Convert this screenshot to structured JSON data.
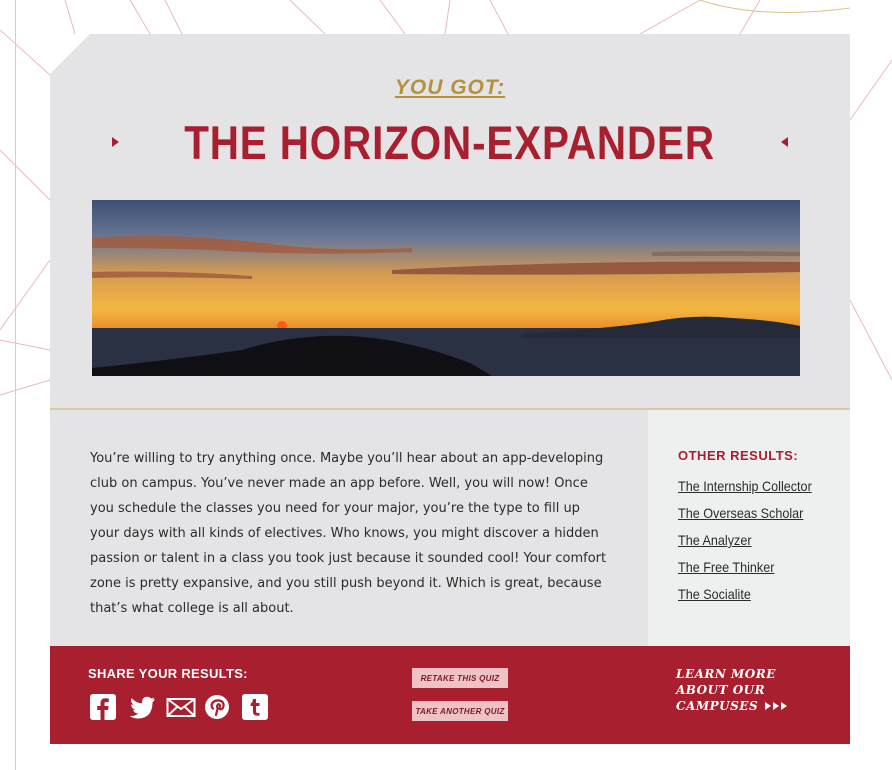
{
  "result": {
    "kicker": "YOU GOT:",
    "title": "THE HORIZON-EXPANDER",
    "description": "You’re willing to try anything once. Maybe you’ll hear about an app-developing club on campus. You’ve never made an app before. Well, you will now! Once you schedule the classes you need for your major, you’re the type to fill up your days with all kinds of electives. Who knows, you might discover a hidden passion or talent in a class you took just because it sounded cool! Your comfort zone is pretty expansive, and you still push beyond it. Which is great, because that’s what college is all about."
  },
  "other_results": {
    "heading": "OTHER RESULTS:",
    "links": [
      "The Internship Collector",
      "The Overseas Scholar",
      "The Analyzer",
      "The Free Thinker",
      "The Socialite"
    ]
  },
  "footer": {
    "share_heading": "SHARE YOUR RESULTS:",
    "social_icons": [
      "facebook-icon",
      "twitter-icon",
      "email-icon",
      "pinterest-icon",
      "tumblr-icon"
    ],
    "retake_label": "RETAKE THIS QUIZ",
    "another_label": "TAKE ANOTHER QUIZ",
    "learn_more_lines": [
      "LEARN MORE",
      "ABOUT OUR",
      "CAMPUSES"
    ]
  },
  "colors": {
    "accent_red": "#a8202f",
    "gold": "#b5923a",
    "panel_gray": "#e4e4e6",
    "button_pink": "#efc3c6"
  }
}
